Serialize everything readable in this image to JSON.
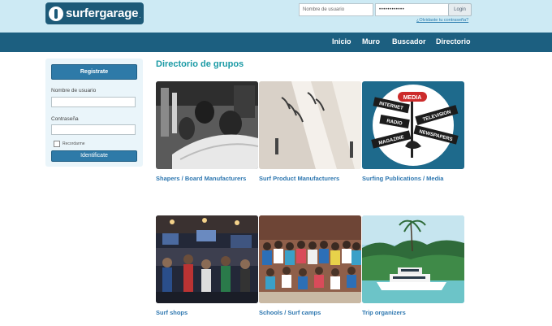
{
  "header": {
    "logo": {
      "text": "surfergarage",
      "suffix": "."
    },
    "login": {
      "username_placeholder": "Nombre de usuario",
      "password_value": "••••••••••••",
      "login_button": "Login",
      "forgot_link": "¿Olvidaste tu contraseña?"
    }
  },
  "nav": {
    "items": [
      {
        "label": "Inicio"
      },
      {
        "label": "Muro"
      },
      {
        "label": "Buscador"
      },
      {
        "label": "Directorio"
      }
    ]
  },
  "sidebar": {
    "register_button": "Registrate",
    "username_label": "Nombre de usuario",
    "password_label": "Contraseña",
    "remember_label": "Recordarme",
    "login_button": "Identificate"
  },
  "main": {
    "title": "Directorio de grupos",
    "groups": [
      {
        "title": "Shapers / Board Manufacturers"
      },
      {
        "title": "Surf Product Manufacturers"
      },
      {
        "title": "Surfing Publications / Media"
      },
      {
        "title": "Surf shops"
      },
      {
        "title": "Schools / Surf camps"
      },
      {
        "title": "Trip organizers"
      }
    ],
    "media_badge": {
      "header": "MEDIA",
      "signs": [
        "INTERNET",
        "TELEVISION",
        "RADIO",
        "MAGAZINE",
        "NEWSPAPERS"
      ]
    }
  },
  "colors": {
    "topbar": "#cdeaf4",
    "navbar": "#1c5f80",
    "accent_title": "#1a9aa5",
    "link": "#2e77b0",
    "button": "#2e7aa8"
  }
}
